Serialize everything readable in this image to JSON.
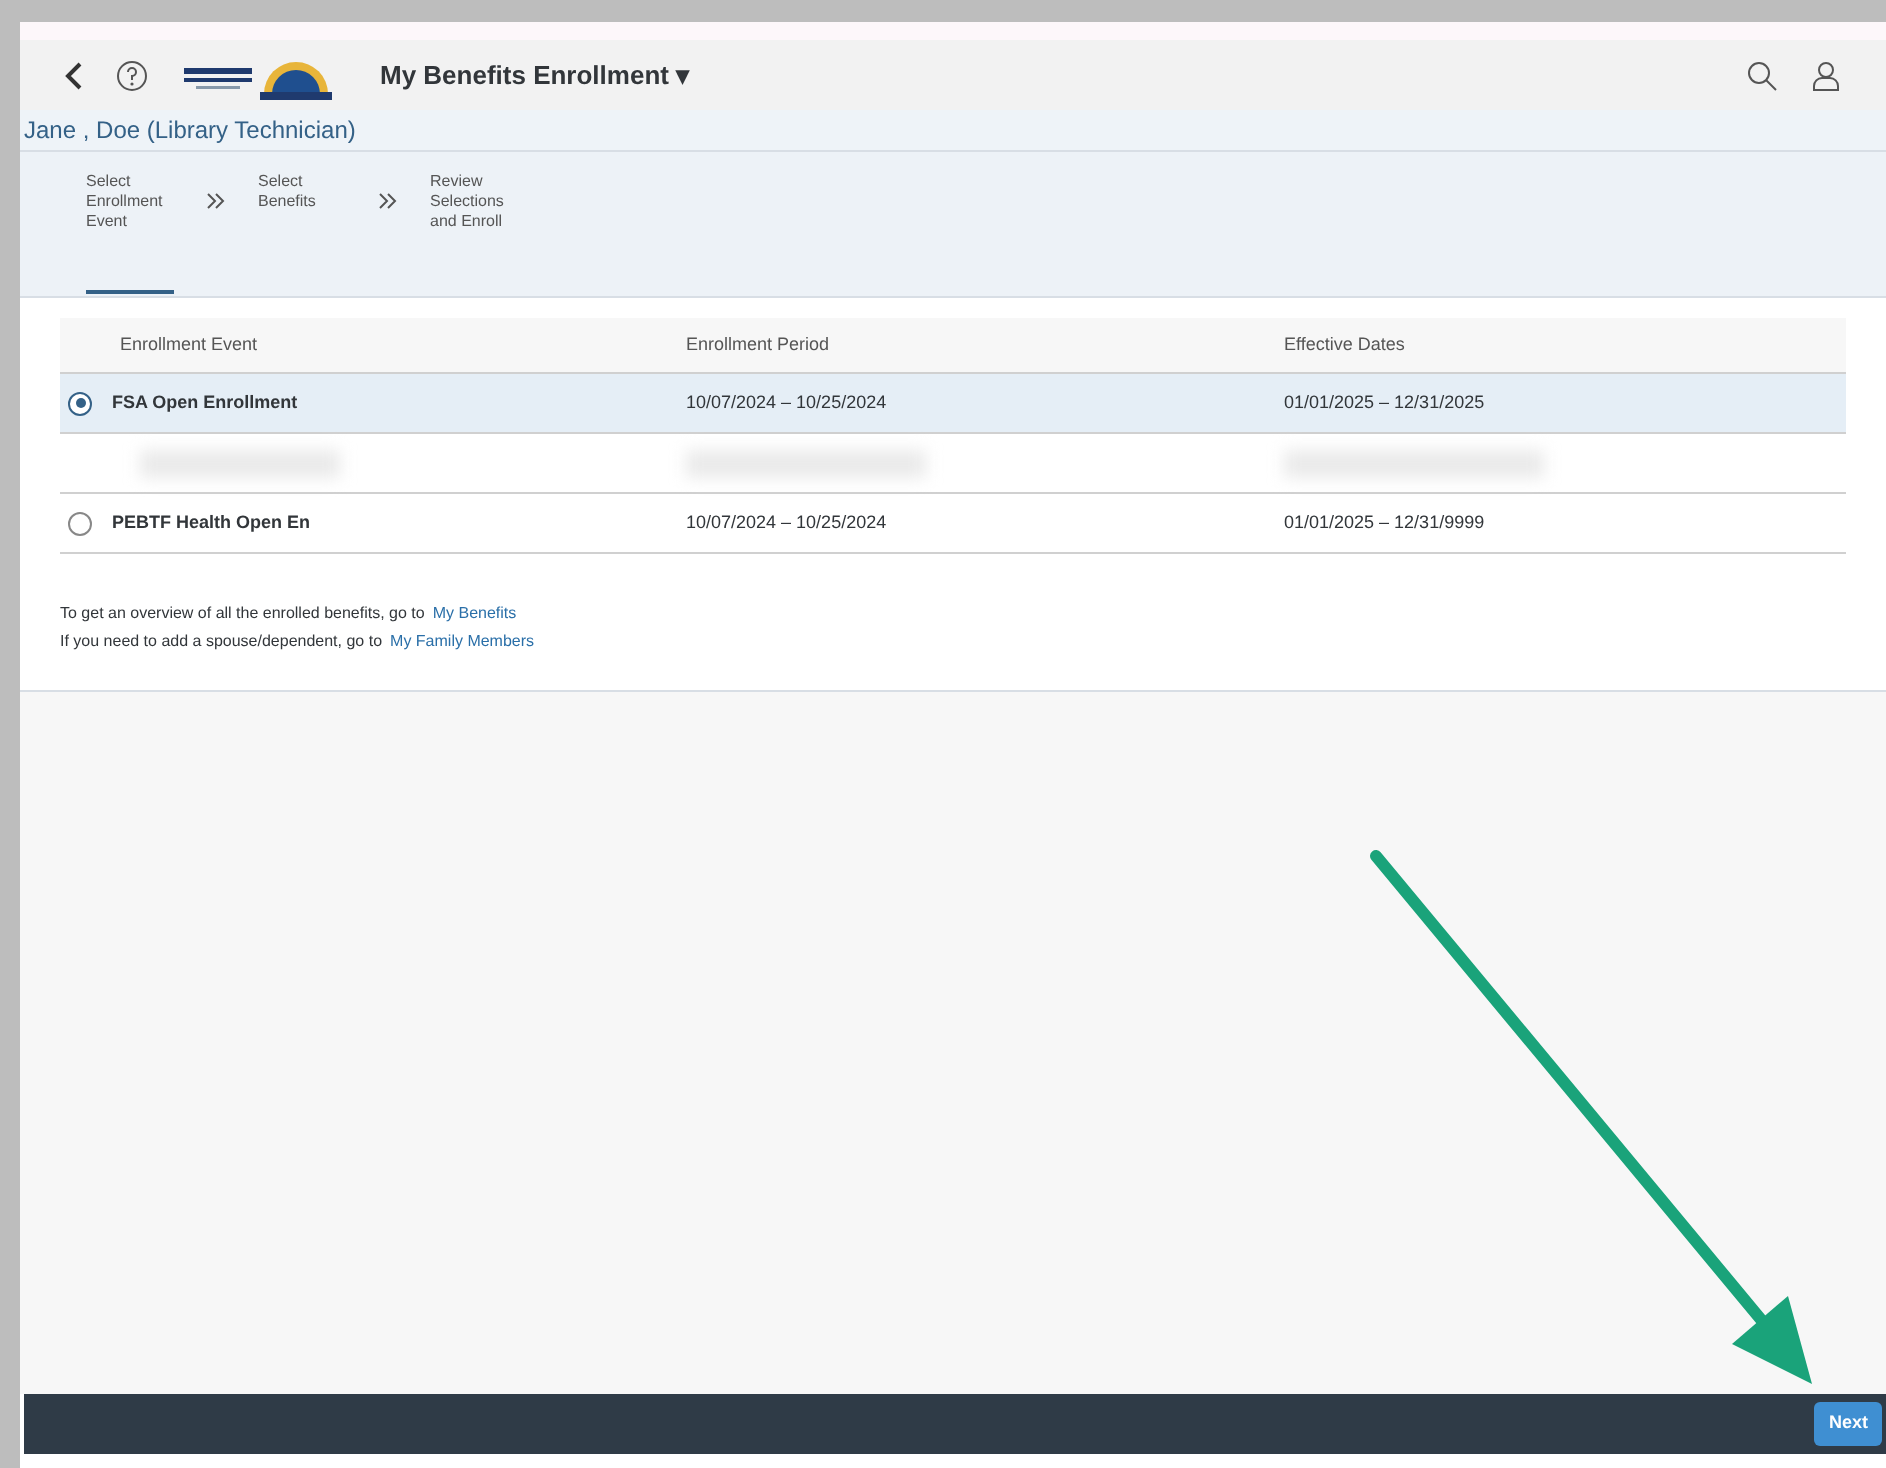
{
  "header": {
    "title": "My Benefits Enrollment ▾"
  },
  "user": {
    "name": "Jane , Doe (Library Technician)"
  },
  "steps": [
    {
      "label": "Select Enrollment Event",
      "selected": true
    },
    {
      "label": "Select Benefits",
      "selected": false
    },
    {
      "label": "Review Selections and Enroll",
      "selected": false
    }
  ],
  "table": {
    "columns": [
      "Enrollment Event",
      "Enrollment Period",
      "Effective Dates"
    ],
    "rows": [
      {
        "kind": "event",
        "selected": true,
        "cells": [
          "FSA Open Enrollment",
          "10/07/2024 – 10/25/2024",
          "01/01/2025 – 12/31/2025"
        ]
      },
      {
        "kind": "blurred"
      },
      {
        "kind": "event",
        "selected": false,
        "cells": [
          "PEBTF Health Open En",
          "10/07/2024 – 10/25/2024",
          "01/01/2025 – 12/31/9999"
        ]
      }
    ]
  },
  "notes": [
    {
      "text": "To get an overview of all the enrolled benefits, go to",
      "link": "My Benefits"
    },
    {
      "text": "If you need to add a spouse/dependent, go to",
      "link": "My Family Members"
    }
  ],
  "footer": {
    "button": "Next"
  }
}
